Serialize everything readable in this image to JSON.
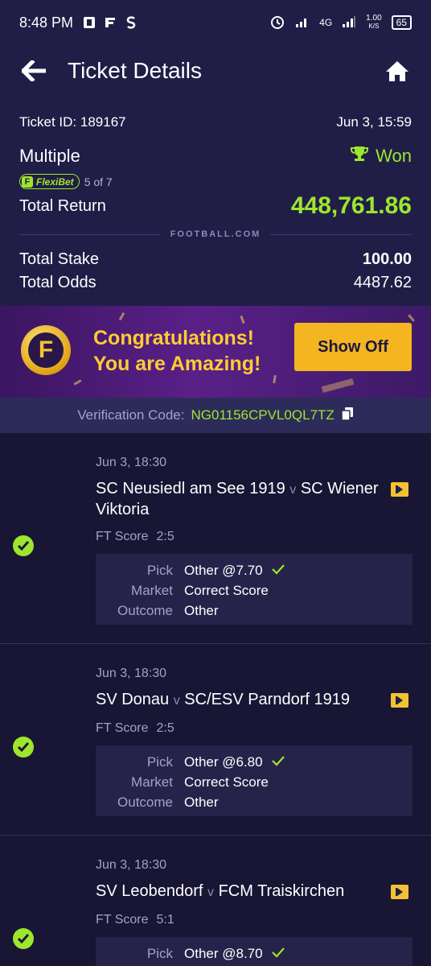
{
  "status_bar": {
    "time": "8:48 PM",
    "network": "4G",
    "speed_value": "1.00",
    "speed_unit": "K/S",
    "battery": "65"
  },
  "header": {
    "title": "Ticket Details"
  },
  "summary": {
    "ticket_id": "Ticket ID: 189167",
    "datetime": "Jun 3, 15:59",
    "bet_type": "Multiple",
    "result": "Won",
    "flexibet_label": "FlexiBet",
    "flexibet_count": "5 of 7",
    "total_return_label": "Total Return",
    "total_return_value": "448,761.86",
    "brand": "FOOTBALL.COM",
    "total_stake_label": "Total Stake",
    "total_stake_value": "100.00",
    "total_odds_label": "Total Odds",
    "total_odds_value": "4487.62"
  },
  "banner": {
    "line1": "Congratulations!",
    "line2": "You are Amazing!",
    "button": "Show Off"
  },
  "verification": {
    "label": "Verification Code:",
    "code": "NG01156CPVL0QL7TZ"
  },
  "selections": [
    {
      "date": "Jun 3, 18:30",
      "home": "SC Neusiedl am See 1919",
      "away": "SC Wiener Viktoria",
      "ft_label": "FT Score",
      "ft_score": "2:5",
      "pick_label": "Pick",
      "pick_value": "Other @7.70",
      "market_label": "Market",
      "market_value": "Correct Score",
      "outcome_label": "Outcome",
      "outcome_value": "Other"
    },
    {
      "date": "Jun 3, 18:30",
      "home": "SV Donau",
      "away": "SC/ESV Parndorf 1919",
      "ft_label": "FT Score",
      "ft_score": "2:5",
      "pick_label": "Pick",
      "pick_value": "Other @6.80",
      "market_label": "Market",
      "market_value": "Correct Score",
      "outcome_label": "Outcome",
      "outcome_value": "Other"
    },
    {
      "date": "Jun 3, 18:30",
      "home": "SV Leobendorf",
      "away": "FCM Traiskirchen",
      "ft_label": "FT Score",
      "ft_score": "5:1",
      "pick_label": "Pick",
      "pick_value": "Other @8.70"
    }
  ],
  "vs_separator": "v",
  "colors": {
    "accent_green": "#9ee62d",
    "header_bg": "#201e47",
    "page_bg": "#181634",
    "button_gold": "#f3b520"
  }
}
